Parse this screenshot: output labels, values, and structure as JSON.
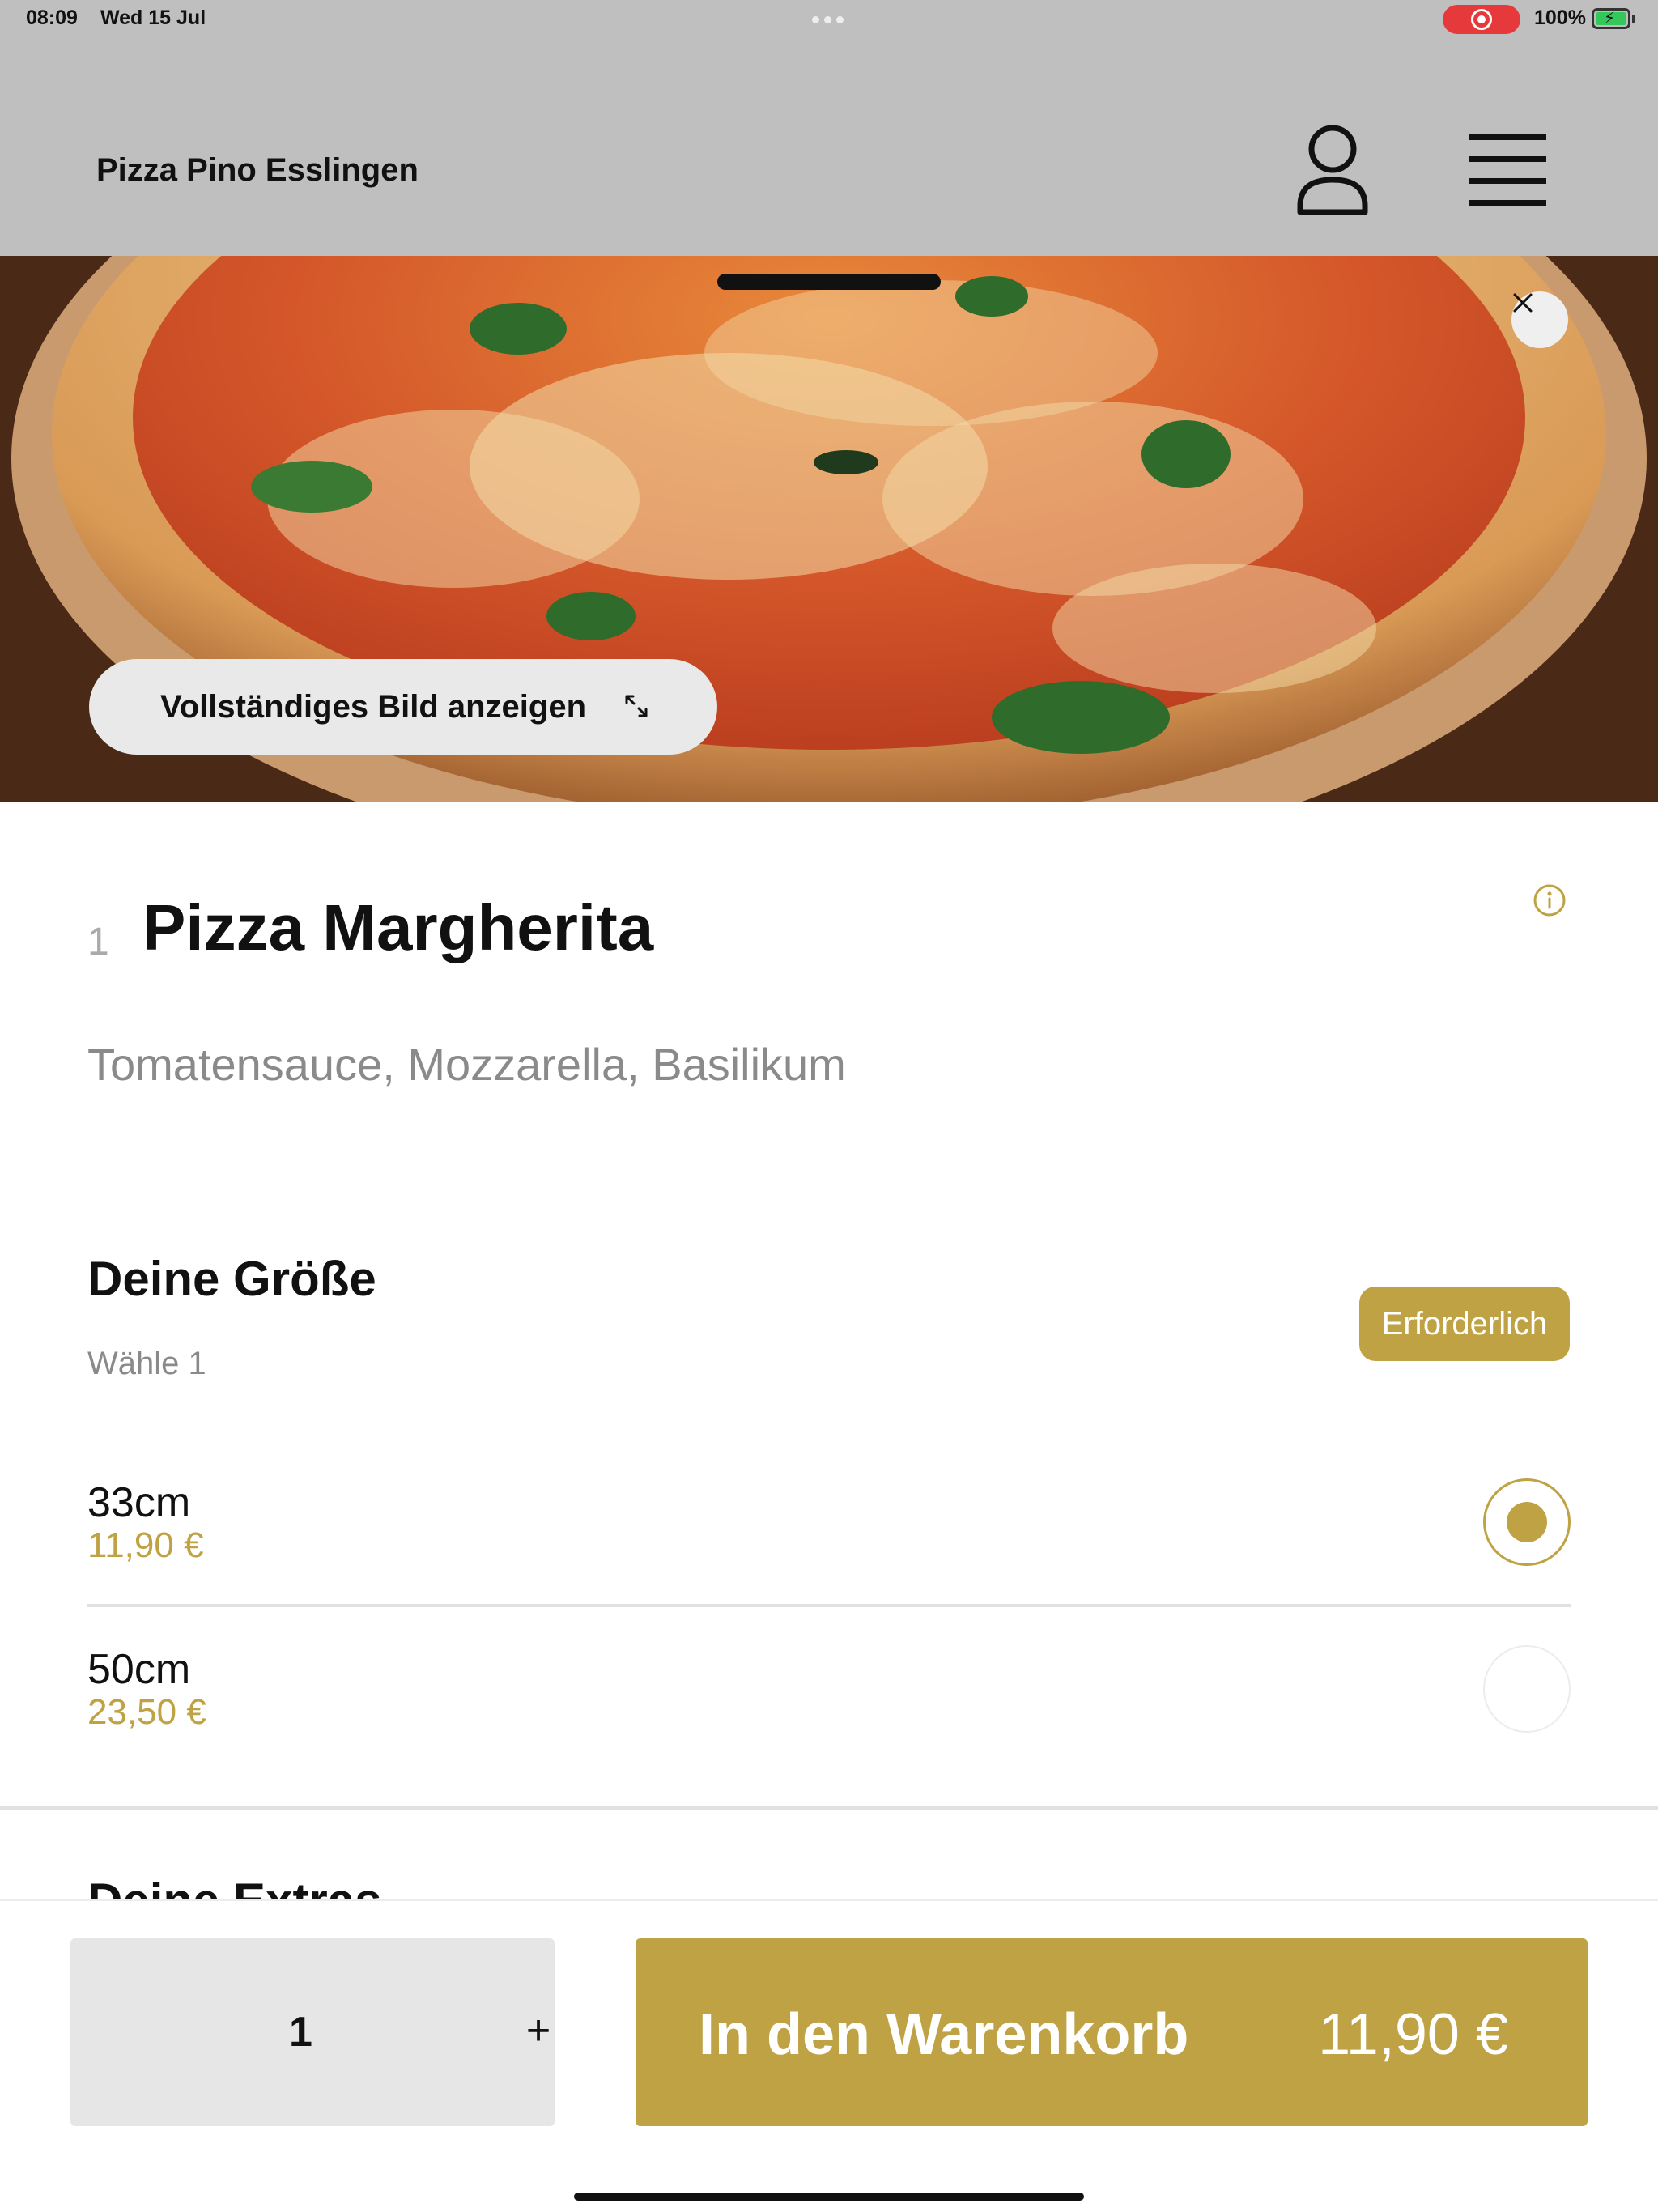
{
  "status_bar": {
    "time": "08:09",
    "date": "Wed 15 Jul",
    "battery": "100%"
  },
  "header": {
    "restaurant": "Pizza Pino Esslingen",
    "profile_icon": "person-icon",
    "menu_icon": "hamburger-menu-icon"
  },
  "hero": {
    "full_image_label": "Vollständiges Bild anzeigen",
    "close_icon": "close-icon",
    "expand_icon": "expand-arrows-icon"
  },
  "product": {
    "number": "1",
    "title": "Pizza Margherita",
    "description": "Tomatensauce, Mozzarella, Basilikum",
    "info_icon": "info-icon"
  },
  "size_section": {
    "title": "Deine Größe",
    "subtitle": "Wähle 1",
    "badge": "Erforderlich",
    "options": [
      {
        "name": "33cm",
        "price": "11,90 €",
        "selected": true
      },
      {
        "name": "50cm",
        "price": "23,50 €",
        "selected": false
      }
    ]
  },
  "next_section": {
    "title": "Deine Extras"
  },
  "bottom_bar": {
    "quantity": "1",
    "plus": "+",
    "cart_label": "In den Warenkorb",
    "cart_price": "11,90 €"
  },
  "colors": {
    "accent": "#bfa244",
    "header_bg": "#bfbfbf",
    "record_red": "#e5393b",
    "battery_green": "#34c759"
  }
}
